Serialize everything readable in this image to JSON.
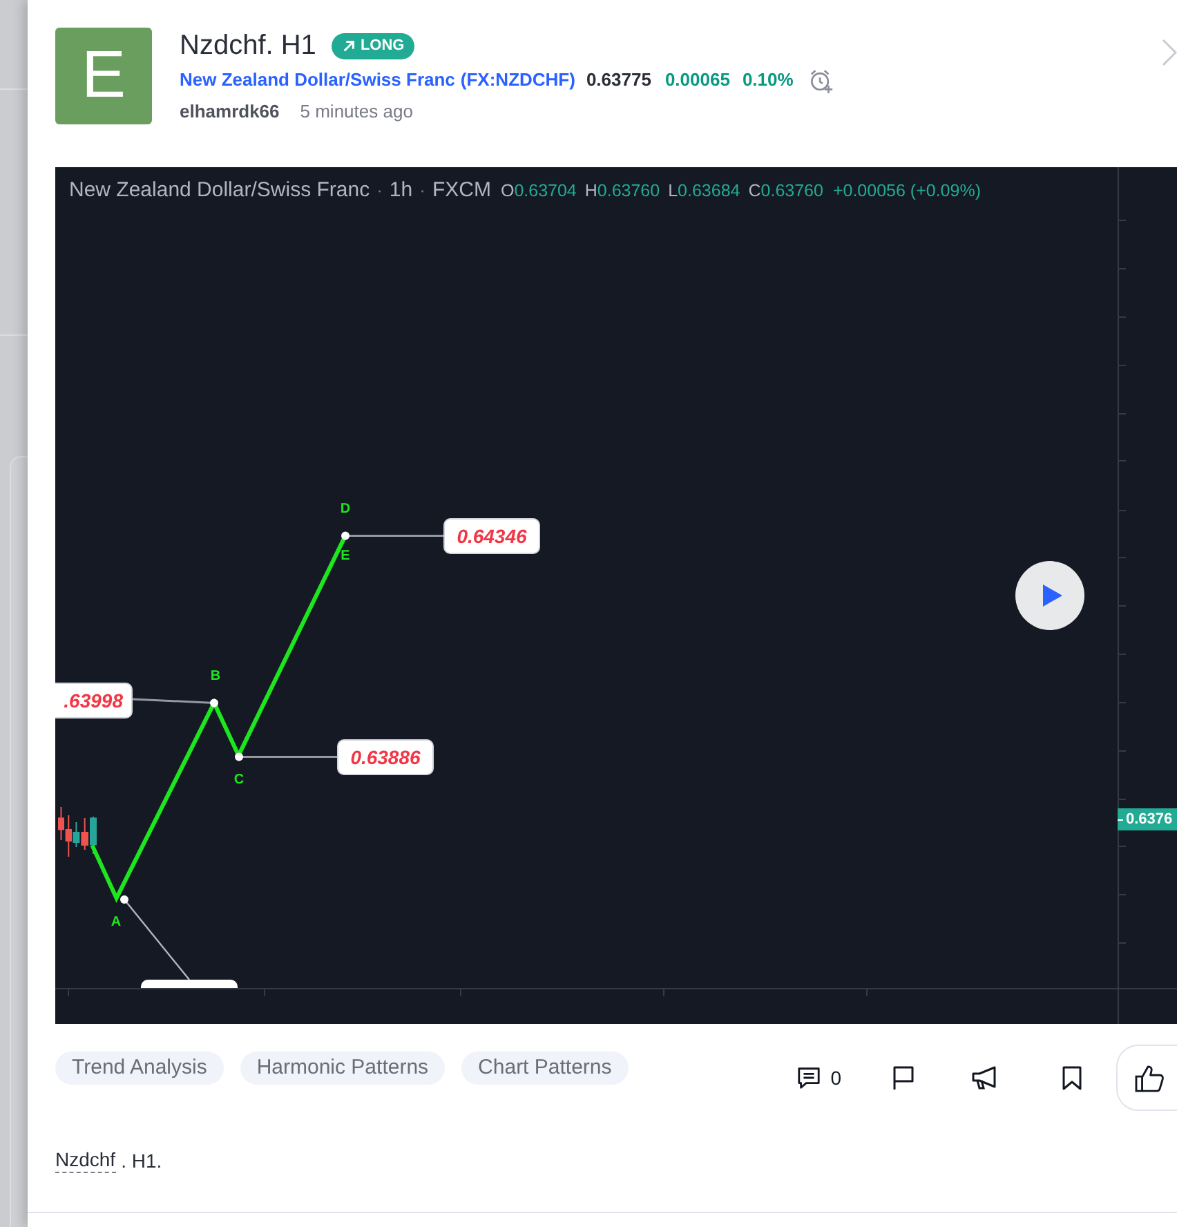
{
  "post": {
    "avatar_letter": "E",
    "title": "Nzdchf. H1",
    "badge": {
      "label": "LONG",
      "kind": "long"
    },
    "symbol": {
      "name": "New Zealand Dollar/Swiss Franc",
      "code": "(FX:NZDCHF)",
      "price": "0.63775",
      "change": "0.00065",
      "change_percent": "0.10%",
      "positive": true
    },
    "author": "elhamrdk66",
    "time": "5 minutes ago"
  },
  "chart": {
    "legend": {
      "title": "New Zealand Dollar/Swiss Franc",
      "separators": [
        "·",
        "·"
      ],
      "interval": "1h",
      "exchange": "FXCM",
      "ohlc": [
        {
          "key": "O",
          "value": "0.63704"
        },
        {
          "key": "H",
          "value": "0.63760"
        },
        {
          "key": "L",
          "value": "0.63684"
        },
        {
          "key": "C",
          "value": "0.63760"
        }
      ],
      "change": "+0.00056 (+0.09%)",
      "positive": true
    },
    "point_labels": [
      "A",
      "B",
      "C",
      "D",
      "E"
    ],
    "price_labels": [
      "0.64346",
      ".63998",
      "0.63886"
    ],
    "current_price": "0.6376"
  },
  "tags": [
    "Trend Analysis",
    "Harmonic Patterns",
    "Chart Patterns"
  ],
  "actions": [
    {
      "kind": "comments",
      "count": "0"
    },
    {
      "kind": "flag"
    },
    {
      "kind": "megaphone"
    },
    {
      "kind": "bookmark"
    },
    {
      "kind": "like"
    }
  ],
  "description": {
    "link": "Nzdchf",
    "text": ". H1."
  }
}
